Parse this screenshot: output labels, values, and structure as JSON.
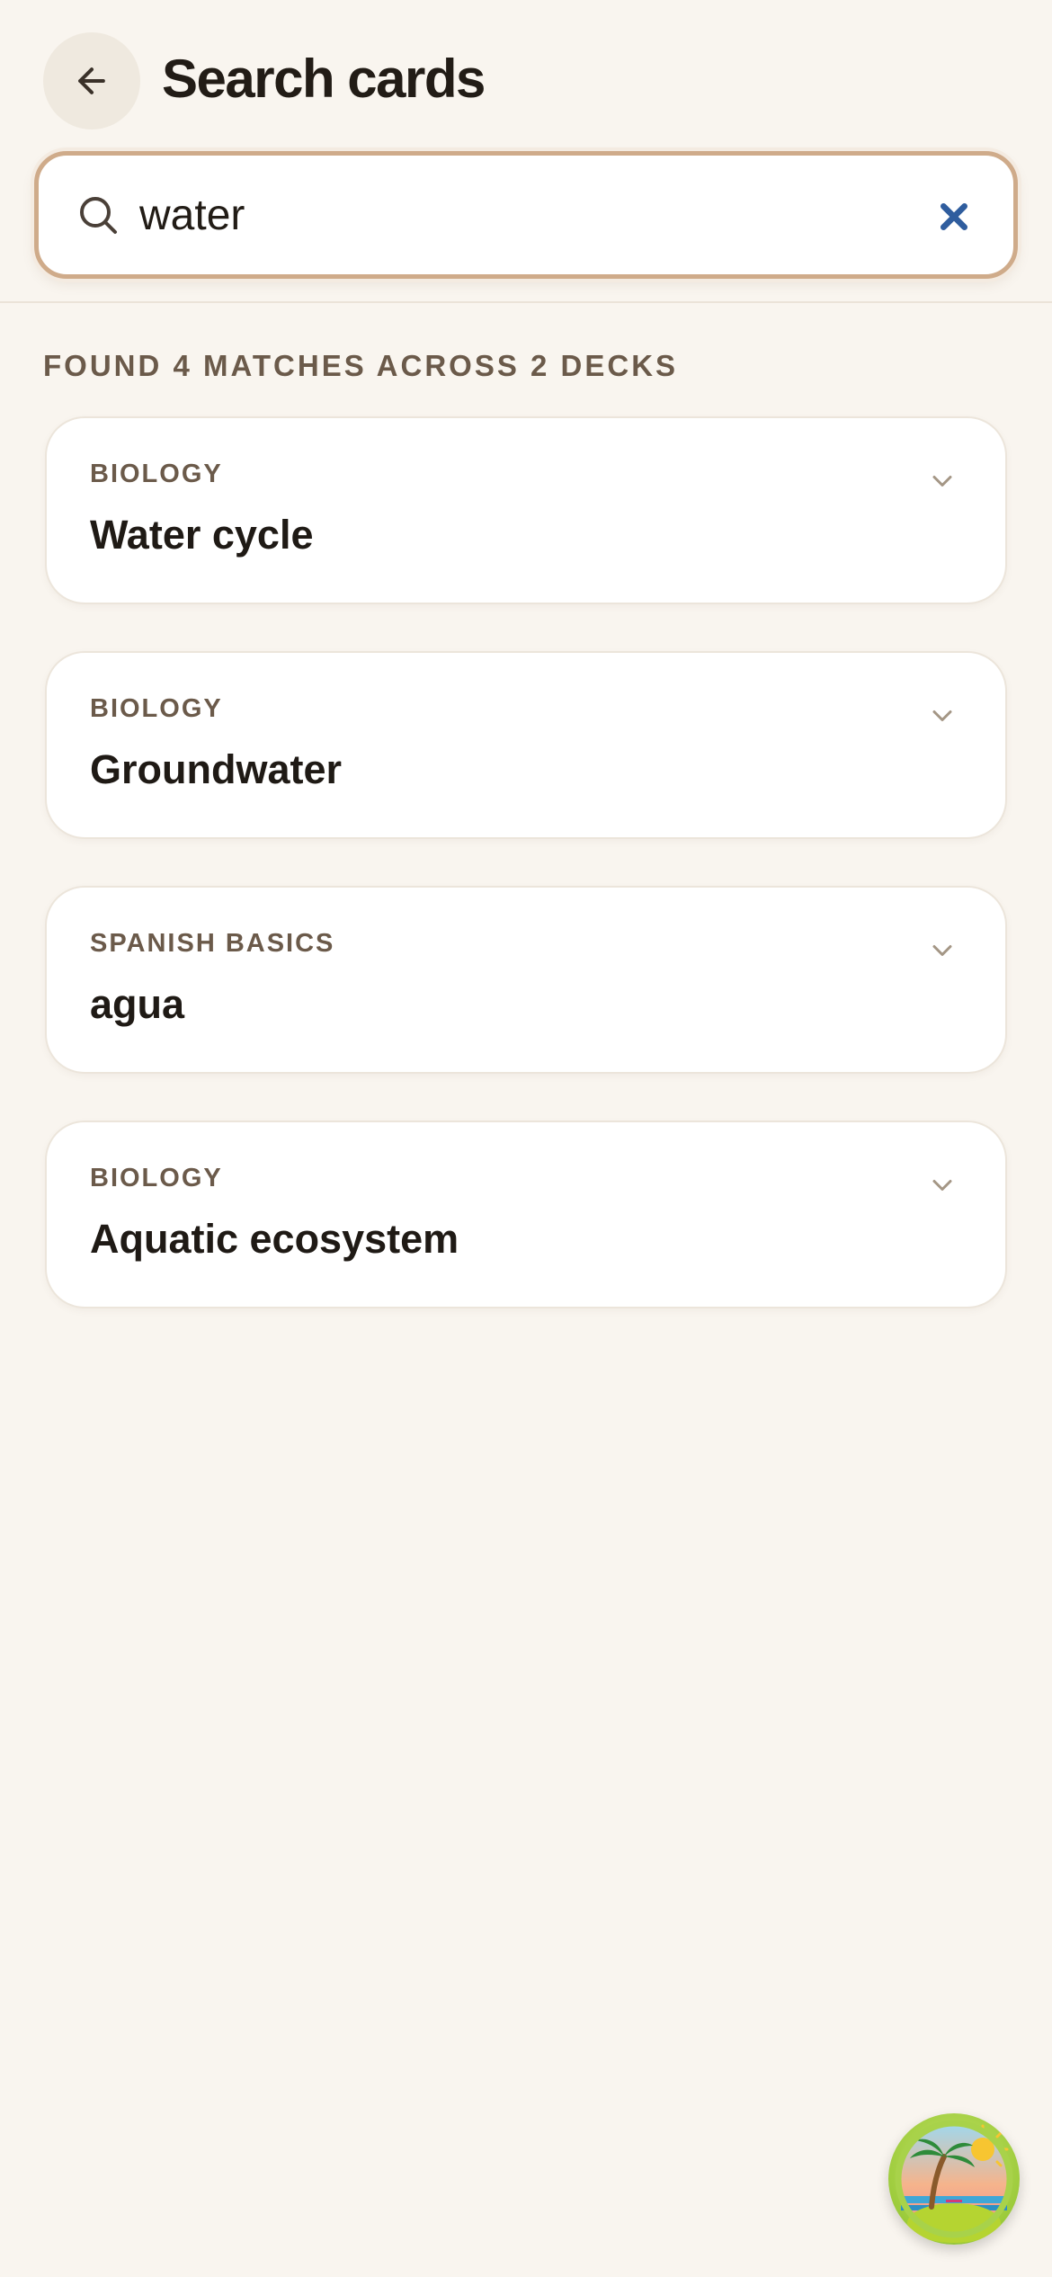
{
  "header": {
    "title": "Search cards",
    "back_icon": "arrow-left-icon"
  },
  "search": {
    "value": "water",
    "placeholder": "Search cards",
    "search_icon": "search-icon",
    "clear_icon": "close-icon",
    "clear_color": "#2f5d9e"
  },
  "results": {
    "summary": "FOUND 4 MATCHES ACROSS 2 DECKS",
    "cards": [
      {
        "deck": "BIOLOGY",
        "term": "Water cycle"
      },
      {
        "deck": "BIOLOGY",
        "term": "Groundwater"
      },
      {
        "deck": "SPANISH BASICS",
        "term": "agua"
      },
      {
        "deck": "BIOLOGY",
        "term": "Aquatic ecosystem"
      }
    ]
  },
  "colors": {
    "background": "#f9f5ef",
    "accent_border": "#cfab8a",
    "deck_label": "#6b5a4a"
  },
  "avatar": {
    "icon": "tropical-island-avatar-icon"
  }
}
